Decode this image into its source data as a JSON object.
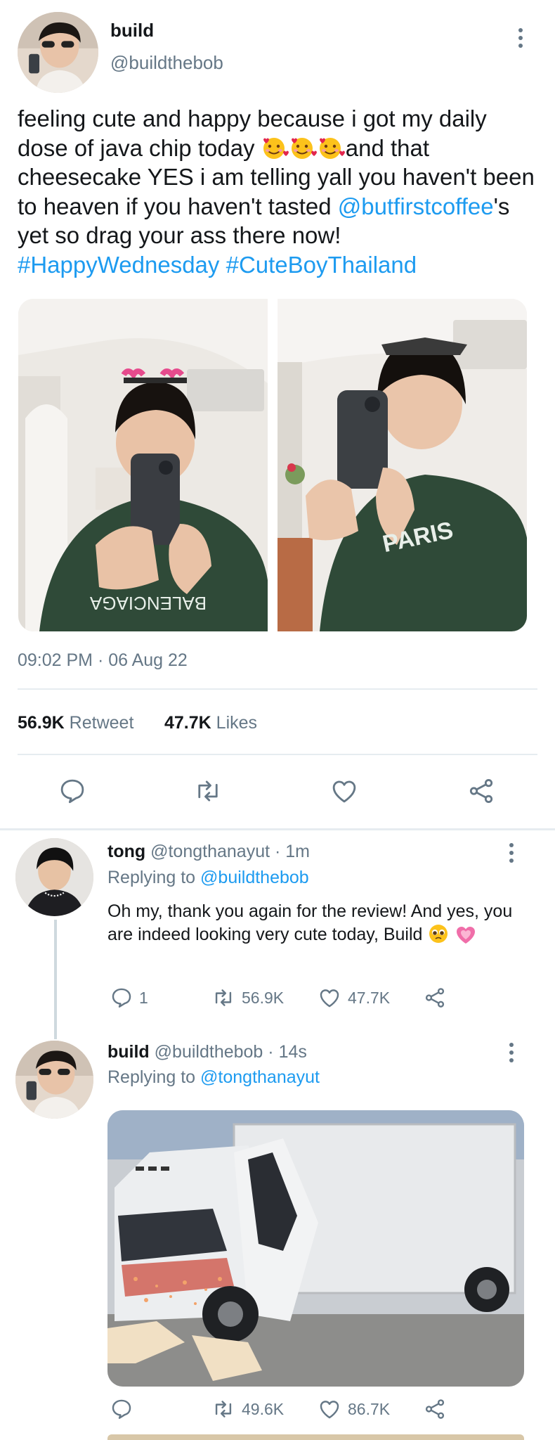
{
  "main_tweet": {
    "author_name": "build",
    "author_handle": "@buildthebob",
    "text_1": "feeling cute and happy because i got my daily dose of java chip today ",
    "text_2": "and that cheesecake YES i am telling yall you haven't been to heaven if you haven't tasted ",
    "mention": "@butfirstcoffee",
    "text_3": "'s yet so drag your ass there now! ",
    "hashtag_1": "#HappyWednesday",
    "hashtag_2": "#CuteBoyThailand",
    "timestamp": "09:02 PM · 06 Aug 22",
    "retweet_count": "56.9K",
    "retweet_label": "Retweet",
    "likes_count": "47.7K",
    "likes_label": "Likes"
  },
  "reply_1": {
    "author_name": "tong",
    "author_handle": "@tongthanayut",
    "time": "· 1m",
    "replying_label": "Replying to",
    "replying_to": "@buildthebob",
    "text": "Oh my, thank you again for the review! And yes, you are indeed looking very cute today, Build",
    "reply_count": "1",
    "retweet_count": "56.9K",
    "like_count": "47.7K"
  },
  "reply_2": {
    "author_name": "build",
    "author_handle": "@buildthebob",
    "time": "· 14s",
    "replying_label": "Replying to",
    "replying_to": "@tongthanayut",
    "retweet_count": "49.6K",
    "like_count": "86.7K"
  },
  "colors": {
    "link": "#1d9bf0",
    "muted": "#657786",
    "divider": "#e6ecf0"
  },
  "icons": [
    "more-vertical-icon",
    "reply-icon",
    "retweet-icon",
    "like-icon",
    "share-icon",
    "smiling-face-with-hearts-emoji",
    "pleading-face-emoji",
    "growing-heart-emoji"
  ]
}
